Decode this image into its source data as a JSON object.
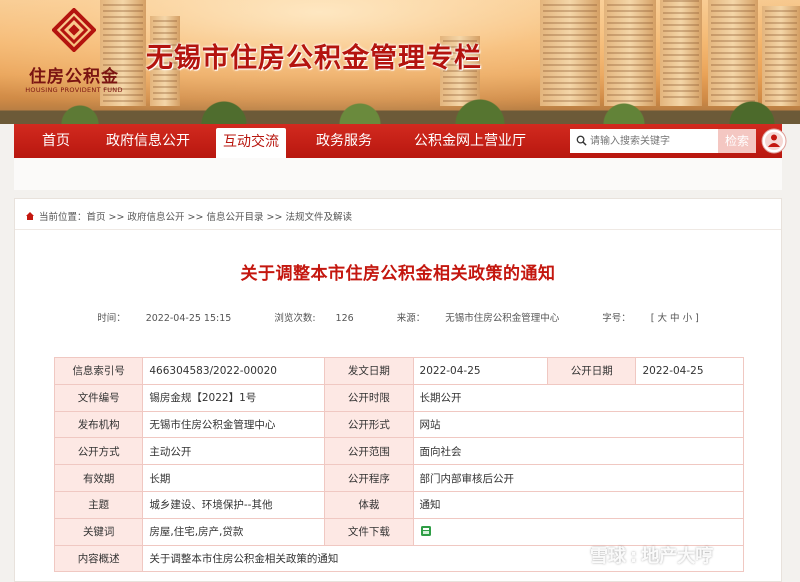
{
  "header": {
    "logo_cn": "住房公积金",
    "logo_en": "HOUSING PROVIDENT FUND",
    "site_title": "无锡市住房公积金管理专栏"
  },
  "nav": {
    "items": [
      {
        "label": "首页"
      },
      {
        "label": "政府信息公开"
      },
      {
        "label": "互动交流"
      },
      {
        "label": "政务服务"
      },
      {
        "label": "公积金网上营业厅"
      }
    ],
    "active_index": 2,
    "search_placeholder": "请输入搜索关键字",
    "search_button": "检索"
  },
  "breadcrumb": {
    "prefix": "当前位置：",
    "items": [
      "首页",
      "政府信息公开",
      "信息公开目录",
      "法规文件及解读"
    ],
    "separator": " >> "
  },
  "article": {
    "title": "关于调整本市住房公积金相关政策的通知",
    "time_label": "时间：",
    "time_value": "2022-04-25 15:15",
    "views_label": "浏览次数:",
    "views_value": "126",
    "source_label": "来源：",
    "source_value": "无锡市住房公积金管理中心",
    "font_label": "字号：",
    "font_value": "[ 大 中 小 ]"
  },
  "info": {
    "index_label": "信息索引号",
    "index_value": "466304583/2022-00020",
    "issue_date_label": "发文日期",
    "issue_date_value": "2022-04-25",
    "open_date_label": "公开日期",
    "open_date_value": "2022-04-25",
    "doc_no_label": "文件编号",
    "doc_no_value": "锡房金规【2022】1号",
    "open_period_label": "公开时限",
    "open_period_value": "长期公开",
    "publisher_label": "发布机构",
    "publisher_value": "无锡市住房公积金管理中心",
    "open_form_label": "公开形式",
    "open_form_value": "网站",
    "open_method_label": "公开方式",
    "open_method_value": "主动公开",
    "open_scope_label": "公开范围",
    "open_scope_value": "面向社会",
    "validity_label": "有效期",
    "validity_value": "长期",
    "procedure_label": "公开程序",
    "procedure_value": "部门内部审核后公开",
    "topic_label": "主题",
    "topic_value": "城乡建设、环境保护--其他",
    "genre_label": "体裁",
    "genre_value": "通知",
    "keywords_label": "关键词",
    "keywords_value": "房屋,住宅,房产,贷款",
    "download_label": "文件下载",
    "summary_label": "内容概述",
    "summary_value": "关于调整本市住房公积金相关政策的通知"
  },
  "watermark": {
    "brand": "雪球",
    "separator": ":",
    "author": "地产大哼"
  },
  "colors": {
    "brand_red": "#b8170f",
    "label_bg": "#fde8e4",
    "title_red": "#c4170f"
  }
}
